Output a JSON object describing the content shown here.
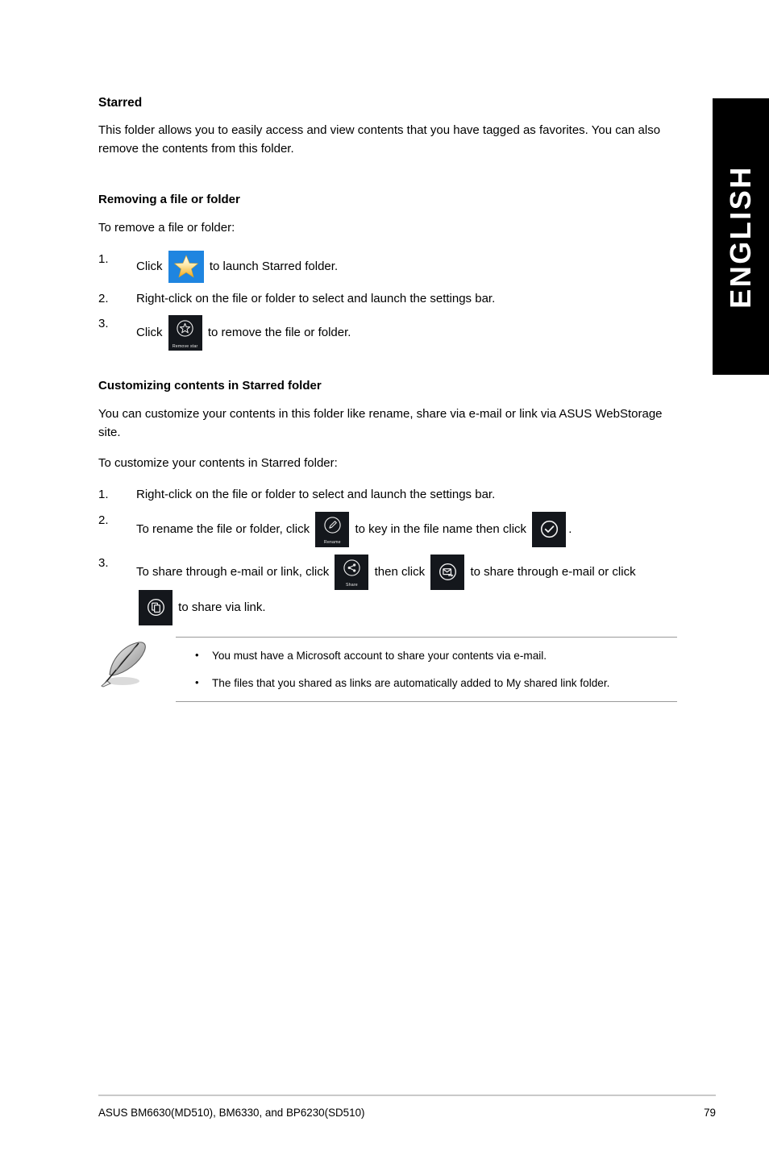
{
  "lang_tab": {
    "label": "ENGLISH"
  },
  "section": {
    "title": "Starred",
    "intro": "This folder allows you to easily access and view contents that you have tagged as favorites. You can also remove the contents from this folder."
  },
  "removing": {
    "heading": "Removing a file or folder",
    "lead": "To remove a file or folder:",
    "steps": [
      {
        "num": "1.",
        "pre": "Click",
        "post": "to launch Starred folder.",
        "icon": "starred-folder-icon"
      },
      {
        "num": "2.",
        "pre": "Right-click on the file or folder to select and launch the settings bar.",
        "post": "",
        "icon": ""
      },
      {
        "num": "3.",
        "pre": "Click",
        "post": "to remove the file or folder.",
        "icon": "remove-star-icon"
      }
    ]
  },
  "customizing": {
    "heading": "Customizing contents in Starred folder",
    "intro": "You can customize your contents in this folder like rename, share via e-mail or link via ASUS WebStorage site.",
    "lead": "To customize your contents in Starred folder:",
    "steps": [
      {
        "num": "1.",
        "text": "Right-click on the file or folder to select and launch the settings bar."
      },
      {
        "num": "2.",
        "t1": "To rename the file or folder, click",
        "t2": "to key in the file name then click",
        "t3": "."
      },
      {
        "num": "3.",
        "t1": "To share through e-mail or link, click",
        "t2": "then click",
        "t3": "to share through e-mail or",
        "t4": "click",
        "t5": "to share via link."
      }
    ]
  },
  "icons": {
    "remove_star_label": "Remove star",
    "rename_label": "Rename",
    "share_label": "Share"
  },
  "note": {
    "items": [
      {
        "bullet": "•",
        "text": "You must have a Microsoft account to share your contents via e-mail."
      },
      {
        "bullet": "•",
        "text": "The files that you shared as links are automatically added to My shared link folder."
      }
    ]
  },
  "footer": {
    "model": "ASUS BM6630(MD510), BM6330, and BP6230(SD510)",
    "page": "79"
  },
  "colors": {
    "tile_dark": "#14171c",
    "tile_blue": "#1f85e0",
    "star_gold": "#f0b323",
    "tab_black": "#000000"
  }
}
